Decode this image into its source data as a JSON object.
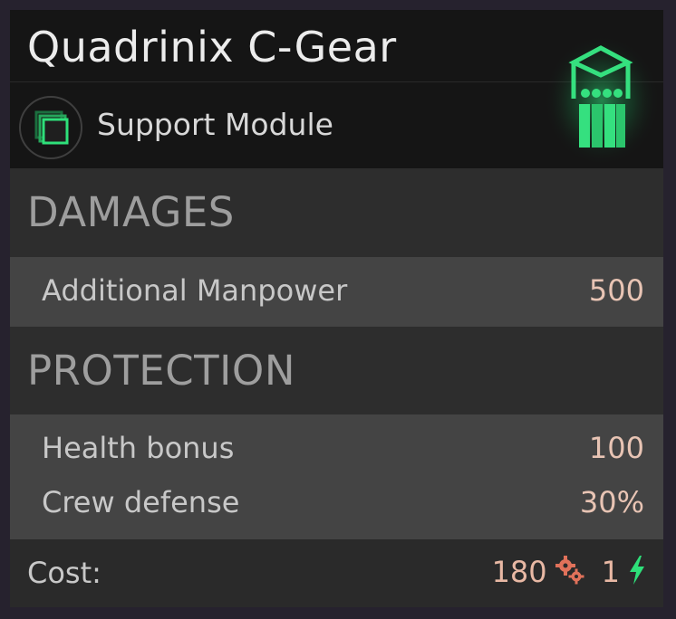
{
  "item": {
    "title": "Quadrinix C-Gear",
    "type_label": "Support Module",
    "type_icon": "stacked-squares-icon",
    "module_icon": "crew-group-icon",
    "accent_color": "#2ee07a"
  },
  "sections": [
    {
      "heading": "DAMAGES",
      "stats": [
        {
          "name": "Additional Manpower",
          "value": "500"
        }
      ]
    },
    {
      "heading": "PROTECTION",
      "stats": [
        {
          "name": "Health bonus",
          "value": "100"
        },
        {
          "name": "Crew defense",
          "value": "30%"
        }
      ]
    }
  ],
  "cost": {
    "label": "Cost:",
    "parts_value": "180",
    "parts_icon": "gears-icon",
    "energy_value": "1",
    "energy_icon": "lightning-icon"
  }
}
